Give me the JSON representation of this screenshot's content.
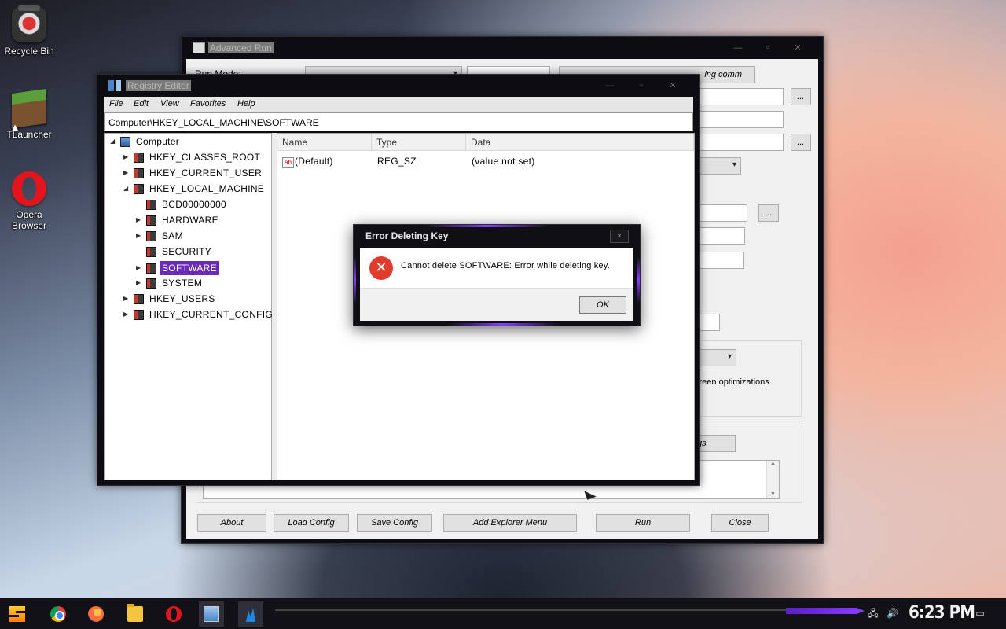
{
  "desktop": {
    "icons": [
      {
        "label": "Recycle Bin"
      },
      {
        "label": "TLauncher"
      },
      {
        "label": "Opera Browser"
      }
    ]
  },
  "advanced_run": {
    "title": "Advanced Run",
    "run_mode_label": "Run Mode:",
    "buttons": {
      "about": "About",
      "load_config": "Load Config",
      "save_config": "Save Config",
      "add_explorer_menu": "Add Explorer Menu",
      "run": "Run",
      "close": "Close",
      "browse": "..."
    },
    "partial_texts": {
      "screen_opt": "creen optimizations",
      "settings_btn": "gs",
      "top_btn": "ing comm"
    }
  },
  "registry_editor": {
    "title": "Registry Editor",
    "menu": [
      "File",
      "Edit",
      "View",
      "Favorites",
      "Help"
    ],
    "address": "Computer\\HKEY_LOCAL_MACHINE\\SOFTWARE",
    "tree": {
      "root": "Computer",
      "hives": [
        "HKEY_CLASSES_ROOT",
        "HKEY_CURRENT_USER",
        "HKEY_LOCAL_MACHINE",
        "HKEY_USERS",
        "HKEY_CURRENT_CONFIG"
      ],
      "hklm_children": [
        "BCD00000000",
        "HARDWARE",
        "SAM",
        "SECURITY",
        "SOFTWARE",
        "SYSTEM"
      ],
      "selected": "SOFTWARE"
    },
    "columns": [
      "Name",
      "Type",
      "Data"
    ],
    "rows": [
      {
        "name": "(Default)",
        "type": "REG_SZ",
        "data": "(value not set)"
      }
    ]
  },
  "error_dialog": {
    "title": "Error Deleting Key",
    "message": "Cannot delete SOFTWARE:  Error while deleting key.",
    "ok": "OK",
    "close": "×",
    "icon": "error-x-icon"
  },
  "taskbar": {
    "apps": [
      "start-icon",
      "chrome-icon",
      "firefox-icon",
      "file-explorer-icon",
      "opera-icon",
      "registry-editor-icon",
      "advanced-run-icon"
    ],
    "clock": "6:23 PM"
  },
  "colors": {
    "accent": "#8a3cff",
    "selection": "#6a2bb8",
    "error": "#e23b2e"
  }
}
